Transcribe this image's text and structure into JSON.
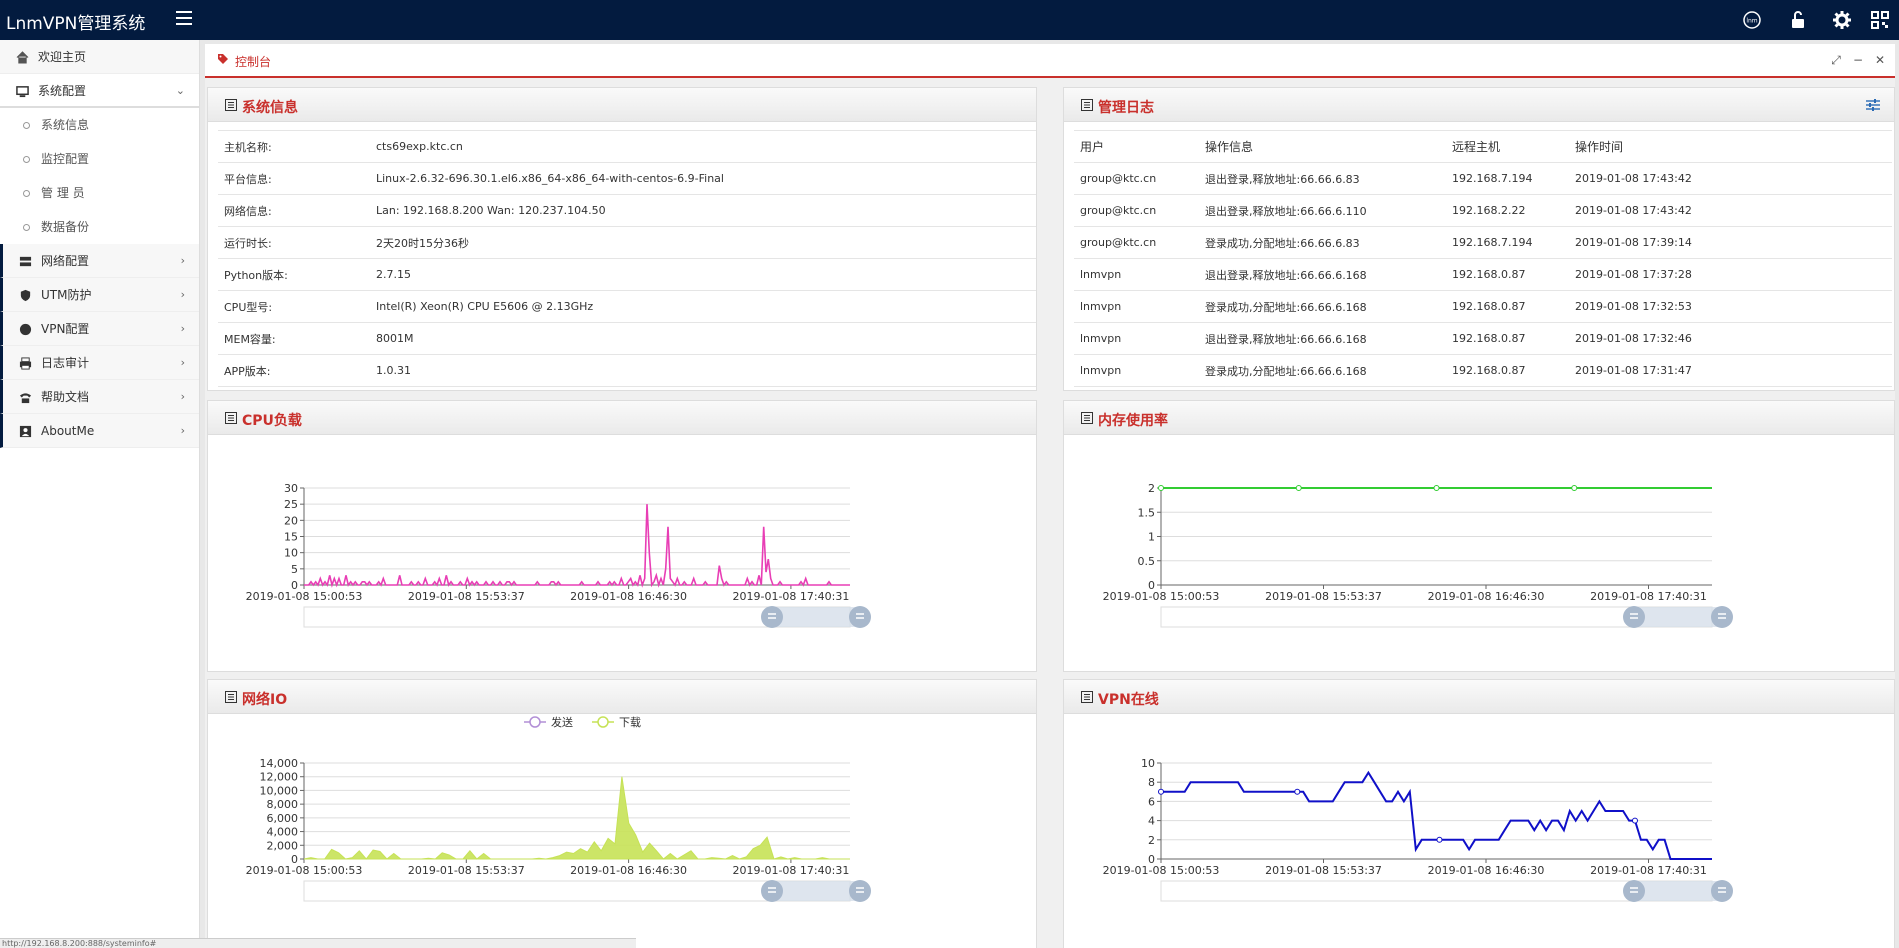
{
  "app": {
    "title": "LnmVPN管理系统",
    "status_url": "http://192.168.8.200:888/systeminfo#"
  },
  "colors": {
    "topbar": "#031b3f",
    "accent": "#c9302c",
    "cpu_line": "#e83eb5",
    "net_fill": "#c6e256",
    "mem_line": "#33cc33",
    "vpn_line": "#1010c8"
  },
  "topbar_icons": [
    "lnm-logo-icon",
    "unlock-icon",
    "gear-icon",
    "qrcode-icon"
  ],
  "sidebar": {
    "items": [
      {
        "label": "欢迎主页",
        "icon": "home-icon"
      },
      {
        "label": "系统配置",
        "icon": "desktop-icon",
        "expanded": true,
        "children": [
          "系统信息",
          "监控配置",
          "管 理 员",
          "数据备份"
        ]
      },
      {
        "label": "网络配置",
        "icon": "server-icon"
      },
      {
        "label": "UTM防护",
        "icon": "shield-icon"
      },
      {
        "label": "VPN配置",
        "icon": "globe-icon"
      },
      {
        "label": "日志审计",
        "icon": "print-icon"
      },
      {
        "label": "帮助文档",
        "icon": "phone-icon"
      },
      {
        "label": "AboutMe",
        "icon": "contact-icon"
      }
    ]
  },
  "tab": {
    "label": "控制台"
  },
  "sysinfo": {
    "title": "系统信息",
    "rows": [
      {
        "k": "主机名称:",
        "v": "cts69exp.ktc.cn"
      },
      {
        "k": "平台信息:",
        "v": "Linux-2.6.32-696.30.1.el6.x86_64-x86_64-with-centos-6.9-Final"
      },
      {
        "k": "网络信息:",
        "v": "Lan: 192.168.8.200 Wan: 120.237.104.50"
      },
      {
        "k": "运行时长:",
        "v": "2天20时15分36秒"
      },
      {
        "k": "Python版本:",
        "v": "2.7.15"
      },
      {
        "k": "CPU型号:",
        "v": "Intel(R) Xeon(R) CPU E5606 @ 2.13GHz"
      },
      {
        "k": "MEM容量:",
        "v": "8001M"
      },
      {
        "k": "APP版本:",
        "v": "1.0.31"
      }
    ]
  },
  "mlog": {
    "title": "管理日志",
    "headers": [
      "用户",
      "操作信息",
      "远程主机",
      "操作时间"
    ],
    "rows": [
      [
        "group@ktc.cn",
        "退出登录,释放地址:66.66.6.83",
        "192.168.7.194",
        "2019-01-08 17:43:42"
      ],
      [
        "group@ktc.cn",
        "退出登录,释放地址:66.66.6.110",
        "192.168.2.22",
        "2019-01-08 17:43:42"
      ],
      [
        "group@ktc.cn",
        "登录成功,分配地址:66.66.6.83",
        "192.168.7.194",
        "2019-01-08 17:39:14"
      ],
      [
        "lnmvpn",
        "退出登录,释放地址:66.66.6.168",
        "192.168.0.87",
        "2019-01-08 17:37:28"
      ],
      [
        "lnmvpn",
        "登录成功,分配地址:66.66.6.168",
        "192.168.0.87",
        "2019-01-08 17:32:53"
      ],
      [
        "lnmvpn",
        "退出登录,释放地址:66.66.6.168",
        "192.168.0.87",
        "2019-01-08 17:32:46"
      ],
      [
        "lnmvpn",
        "登录成功,分配地址:66.66.6.168",
        "192.168.0.87",
        "2019-01-08 17:31:47"
      ]
    ]
  },
  "panels": {
    "cpu": "CPU负载",
    "mem": "内存使用率",
    "net": "网络IO",
    "vpn": "VPN在线"
  },
  "chart_data": [
    {
      "id": "cpu",
      "type": "line",
      "title": "",
      "x_ticks": [
        "2019-01-08 15:00:53",
        "2019-01-08 15:53:37",
        "2019-01-08 16:46:30",
        "2019-01-08 17:40:31"
      ],
      "y_ticks": [
        "0",
        "5",
        "10",
        "15",
        "20",
        "25",
        "30"
      ],
      "ylim": [
        0,
        30
      ],
      "series": [
        {
          "values": [
            0,
            0,
            0,
            1,
            0,
            1,
            0,
            2,
            0,
            1,
            0,
            3,
            0,
            2,
            0,
            2,
            0,
            0,
            3,
            0,
            1,
            0,
            1,
            0,
            0,
            1,
            1,
            0,
            1,
            0,
            0,
            0,
            1,
            0,
            2,
            0,
            0,
            0,
            0,
            0,
            0,
            3,
            0,
            0,
            0,
            0,
            1,
            0,
            0,
            1,
            0,
            0,
            2,
            0,
            0,
            0,
            1,
            0,
            2,
            0,
            0,
            3,
            0,
            1,
            0,
            0,
            0,
            1,
            0,
            0,
            2,
            0,
            1,
            0,
            1,
            0,
            0,
            0,
            1,
            0,
            0,
            1,
            0,
            0,
            1,
            0,
            0,
            1,
            1,
            0,
            1,
            0,
            0,
            0,
            0,
            0,
            0,
            0,
            0,
            0,
            1,
            0,
            0,
            0,
            0,
            0,
            1,
            1,
            0,
            1,
            0,
            0,
            0,
            0,
            0,
            0,
            0,
            0,
            0,
            1,
            0,
            0,
            0,
            0,
            0,
            0,
            1,
            0,
            0,
            0,
            0,
            1,
            0,
            1,
            0,
            0,
            2,
            0,
            0,
            1,
            2,
            0,
            1,
            0,
            3,
            0,
            2,
            25,
            10,
            0,
            1,
            3,
            0,
            2,
            0,
            5,
            18,
            2,
            1,
            0,
            2,
            0,
            0,
            1,
            0,
            0,
            0,
            2,
            0,
            0,
            0,
            0,
            1,
            0,
            0,
            0,
            0,
            0,
            6,
            2,
            0,
            1,
            0,
            0,
            0,
            0,
            0,
            0,
            0,
            0,
            2,
            0,
            1,
            0,
            0,
            3,
            0,
            18,
            4,
            8,
            2,
            0,
            0,
            0,
            1,
            0,
            0,
            0,
            0,
            0,
            0,
            0,
            0,
            1,
            0,
            2,
            0,
            0,
            0,
            0,
            0,
            0,
            0,
            0,
            0,
            1,
            0,
            0,
            0,
            0,
            0,
            0,
            0,
            0,
            0
          ]
        }
      ]
    },
    {
      "id": "mem",
      "type": "line",
      "title": "",
      "x_ticks": [
        "2019-01-08 15:00:53",
        "2019-01-08 15:53:37",
        "2019-01-08 16:46:30",
        "2019-01-08 17:40:31"
      ],
      "y_ticks": [
        "0",
        "0.5",
        "1",
        "1.5",
        "2"
      ],
      "ylim": [
        0,
        2
      ],
      "series": [
        {
          "values": [
            2,
            2,
            2,
            2,
            2
          ]
        }
      ]
    },
    {
      "id": "net",
      "type": "area",
      "title": "",
      "x_ticks": [
        "2019-01-08 15:00:53",
        "2019-01-08 15:53:37",
        "2019-01-08 16:46:30",
        "2019-01-08 17:40:31"
      ],
      "y_ticks": [
        "0",
        "2,000",
        "4,000",
        "6,000",
        "8,000",
        "10,000",
        "12,000",
        "14,000"
      ],
      "ylim": [
        0,
        14000
      ],
      "legend": [
        "发送",
        "下载"
      ],
      "series": [
        {
          "name": "发送",
          "values": [
            0,
            0,
            0,
            0,
            0,
            0,
            0,
            0,
            0,
            0,
            0,
            0,
            0,
            0,
            0,
            0,
            0,
            0,
            0,
            0,
            0,
            0,
            0,
            0,
            0,
            0,
            0,
            0,
            0,
            0,
            0,
            0,
            0,
            0,
            0,
            0,
            0,
            0,
            0,
            0,
            0,
            0,
            0,
            0,
            0,
            0,
            0,
            0,
            0,
            0
          ]
        },
        {
          "name": "下载",
          "values": [
            0,
            200,
            0,
            0,
            1400,
            900,
            0,
            200,
            1200,
            0,
            1300,
            1100,
            0,
            800,
            0,
            0,
            0,
            0,
            100,
            0,
            900,
            600,
            0,
            0,
            1200,
            0,
            800,
            0,
            0,
            0,
            0,
            0,
            0,
            0,
            100,
            0,
            200,
            500,
            1000,
            800,
            1500,
            1000,
            2500,
            1200,
            3000,
            2200,
            12000,
            5200,
            3500,
            1000,
            2300,
            1200,
            0,
            800,
            0,
            600,
            1200,
            0,
            0,
            200,
            100,
            0,
            500,
            0,
            300,
            1500,
            2000,
            3200,
            0,
            300,
            0,
            200,
            0,
            0,
            0,
            200,
            0,
            0,
            0,
            0
          ]
        }
      ]
    },
    {
      "id": "vpn",
      "type": "line",
      "title": "",
      "x_ticks": [
        "2019-01-08 15:00:53",
        "2019-01-08 15:53:37",
        "2019-01-08 16:46:30",
        "2019-01-08 17:40:31"
      ],
      "y_ticks": [
        "0",
        "2",
        "4",
        "6",
        "8",
        "10"
      ],
      "ylim": [
        0,
        10
      ],
      "series": [
        {
          "values": [
            7,
            7,
            7,
            7,
            7,
            8,
            8,
            8,
            8,
            8,
            8,
            8,
            8,
            8,
            7,
            7,
            7,
            7,
            7,
            7,
            7,
            7,
            7,
            7,
            7,
            6,
            6,
            6,
            6,
            6,
            7,
            8,
            8,
            8,
            8,
            9,
            8,
            7,
            6,
            6,
            7,
            6,
            7,
            1,
            2,
            2,
            2,
            2,
            2,
            2,
            2,
            2,
            1,
            2,
            2,
            2,
            2,
            2,
            3,
            4,
            4,
            4,
            4,
            3,
            4,
            3,
            4,
            4,
            3,
            5,
            4,
            5,
            4,
            5,
            6,
            5,
            5,
            5,
            5,
            4,
            4,
            2,
            2,
            1,
            2,
            2,
            0,
            0,
            0,
            0,
            0,
            0,
            0,
            0
          ]
        }
      ]
    }
  ]
}
